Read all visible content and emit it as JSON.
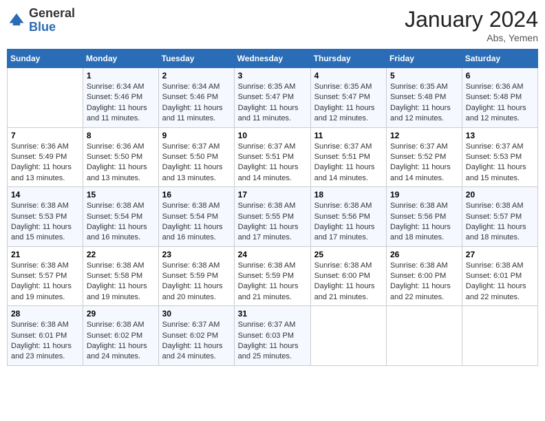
{
  "logo": {
    "general": "General",
    "blue": "Blue"
  },
  "header": {
    "month": "January 2024",
    "location": "Abs, Yemen"
  },
  "weekdays": [
    "Sunday",
    "Monday",
    "Tuesday",
    "Wednesday",
    "Thursday",
    "Friday",
    "Saturday"
  ],
  "weeks": [
    [
      {
        "day": "",
        "sunrise": "",
        "sunset": "",
        "daylight": ""
      },
      {
        "day": "1",
        "sunrise": "Sunrise: 6:34 AM",
        "sunset": "Sunset: 5:46 PM",
        "daylight": "Daylight: 11 hours and 11 minutes."
      },
      {
        "day": "2",
        "sunrise": "Sunrise: 6:34 AM",
        "sunset": "Sunset: 5:46 PM",
        "daylight": "Daylight: 11 hours and 11 minutes."
      },
      {
        "day": "3",
        "sunrise": "Sunrise: 6:35 AM",
        "sunset": "Sunset: 5:47 PM",
        "daylight": "Daylight: 11 hours and 11 minutes."
      },
      {
        "day": "4",
        "sunrise": "Sunrise: 6:35 AM",
        "sunset": "Sunset: 5:47 PM",
        "daylight": "Daylight: 11 hours and 12 minutes."
      },
      {
        "day": "5",
        "sunrise": "Sunrise: 6:35 AM",
        "sunset": "Sunset: 5:48 PM",
        "daylight": "Daylight: 11 hours and 12 minutes."
      },
      {
        "day": "6",
        "sunrise": "Sunrise: 6:36 AM",
        "sunset": "Sunset: 5:48 PM",
        "daylight": "Daylight: 11 hours and 12 minutes."
      }
    ],
    [
      {
        "day": "7",
        "sunrise": "Sunrise: 6:36 AM",
        "sunset": "Sunset: 5:49 PM",
        "daylight": "Daylight: 11 hours and 13 minutes."
      },
      {
        "day": "8",
        "sunrise": "Sunrise: 6:36 AM",
        "sunset": "Sunset: 5:50 PM",
        "daylight": "Daylight: 11 hours and 13 minutes."
      },
      {
        "day": "9",
        "sunrise": "Sunrise: 6:37 AM",
        "sunset": "Sunset: 5:50 PM",
        "daylight": "Daylight: 11 hours and 13 minutes."
      },
      {
        "day": "10",
        "sunrise": "Sunrise: 6:37 AM",
        "sunset": "Sunset: 5:51 PM",
        "daylight": "Daylight: 11 hours and 14 minutes."
      },
      {
        "day": "11",
        "sunrise": "Sunrise: 6:37 AM",
        "sunset": "Sunset: 5:51 PM",
        "daylight": "Daylight: 11 hours and 14 minutes."
      },
      {
        "day": "12",
        "sunrise": "Sunrise: 6:37 AM",
        "sunset": "Sunset: 5:52 PM",
        "daylight": "Daylight: 11 hours and 14 minutes."
      },
      {
        "day": "13",
        "sunrise": "Sunrise: 6:37 AM",
        "sunset": "Sunset: 5:53 PM",
        "daylight": "Daylight: 11 hours and 15 minutes."
      }
    ],
    [
      {
        "day": "14",
        "sunrise": "Sunrise: 6:38 AM",
        "sunset": "Sunset: 5:53 PM",
        "daylight": "Daylight: 11 hours and 15 minutes."
      },
      {
        "day": "15",
        "sunrise": "Sunrise: 6:38 AM",
        "sunset": "Sunset: 5:54 PM",
        "daylight": "Daylight: 11 hours and 16 minutes."
      },
      {
        "day": "16",
        "sunrise": "Sunrise: 6:38 AM",
        "sunset": "Sunset: 5:54 PM",
        "daylight": "Daylight: 11 hours and 16 minutes."
      },
      {
        "day": "17",
        "sunrise": "Sunrise: 6:38 AM",
        "sunset": "Sunset: 5:55 PM",
        "daylight": "Daylight: 11 hours and 17 minutes."
      },
      {
        "day": "18",
        "sunrise": "Sunrise: 6:38 AM",
        "sunset": "Sunset: 5:56 PM",
        "daylight": "Daylight: 11 hours and 17 minutes."
      },
      {
        "day": "19",
        "sunrise": "Sunrise: 6:38 AM",
        "sunset": "Sunset: 5:56 PM",
        "daylight": "Daylight: 11 hours and 18 minutes."
      },
      {
        "day": "20",
        "sunrise": "Sunrise: 6:38 AM",
        "sunset": "Sunset: 5:57 PM",
        "daylight": "Daylight: 11 hours and 18 minutes."
      }
    ],
    [
      {
        "day": "21",
        "sunrise": "Sunrise: 6:38 AM",
        "sunset": "Sunset: 5:57 PM",
        "daylight": "Daylight: 11 hours and 19 minutes."
      },
      {
        "day": "22",
        "sunrise": "Sunrise: 6:38 AM",
        "sunset": "Sunset: 5:58 PM",
        "daylight": "Daylight: 11 hours and 19 minutes."
      },
      {
        "day": "23",
        "sunrise": "Sunrise: 6:38 AM",
        "sunset": "Sunset: 5:59 PM",
        "daylight": "Daylight: 11 hours and 20 minutes."
      },
      {
        "day": "24",
        "sunrise": "Sunrise: 6:38 AM",
        "sunset": "Sunset: 5:59 PM",
        "daylight": "Daylight: 11 hours and 21 minutes."
      },
      {
        "day": "25",
        "sunrise": "Sunrise: 6:38 AM",
        "sunset": "Sunset: 6:00 PM",
        "daylight": "Daylight: 11 hours and 21 minutes."
      },
      {
        "day": "26",
        "sunrise": "Sunrise: 6:38 AM",
        "sunset": "Sunset: 6:00 PM",
        "daylight": "Daylight: 11 hours and 22 minutes."
      },
      {
        "day": "27",
        "sunrise": "Sunrise: 6:38 AM",
        "sunset": "Sunset: 6:01 PM",
        "daylight": "Daylight: 11 hours and 22 minutes."
      }
    ],
    [
      {
        "day": "28",
        "sunrise": "Sunrise: 6:38 AM",
        "sunset": "Sunset: 6:01 PM",
        "daylight": "Daylight: 11 hours and 23 minutes."
      },
      {
        "day": "29",
        "sunrise": "Sunrise: 6:38 AM",
        "sunset": "Sunset: 6:02 PM",
        "daylight": "Daylight: 11 hours and 24 minutes."
      },
      {
        "day": "30",
        "sunrise": "Sunrise: 6:37 AM",
        "sunset": "Sunset: 6:02 PM",
        "daylight": "Daylight: 11 hours and 24 minutes."
      },
      {
        "day": "31",
        "sunrise": "Sunrise: 6:37 AM",
        "sunset": "Sunset: 6:03 PM",
        "daylight": "Daylight: 11 hours and 25 minutes."
      },
      {
        "day": "",
        "sunrise": "",
        "sunset": "",
        "daylight": ""
      },
      {
        "day": "",
        "sunrise": "",
        "sunset": "",
        "daylight": ""
      },
      {
        "day": "",
        "sunrise": "",
        "sunset": "",
        "daylight": ""
      }
    ]
  ]
}
